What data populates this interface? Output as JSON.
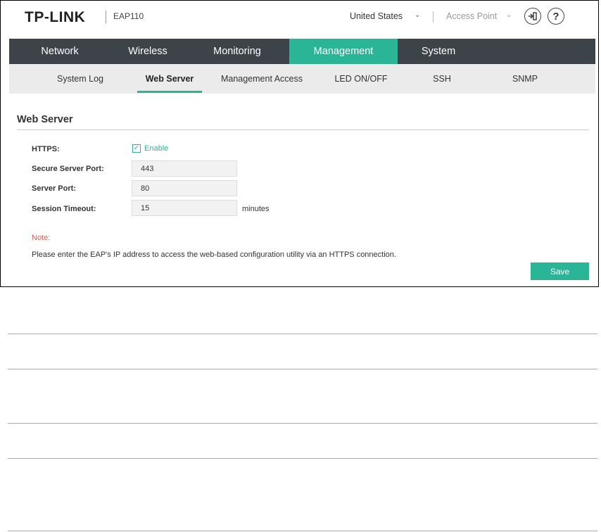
{
  "header": {
    "brand": "TP-LINK",
    "model": "EAP110",
    "region": "United States",
    "mode": "Access Point",
    "logout_icon": "logout-icon",
    "help_icon": "help-icon",
    "help_glyph": "?"
  },
  "main_nav": {
    "tabs": [
      {
        "label": "Network"
      },
      {
        "label": "Wireless"
      },
      {
        "label": "Monitoring"
      },
      {
        "label": "Management",
        "active": true
      },
      {
        "label": "System"
      }
    ]
  },
  "sub_nav": {
    "tabs": [
      {
        "label": "System Log"
      },
      {
        "label": "Web Server",
        "active": true
      },
      {
        "label": "Management Access"
      },
      {
        "label": "LED ON/OFF"
      },
      {
        "label": "SSH"
      },
      {
        "label": "SNMP"
      }
    ]
  },
  "web_server": {
    "title": "Web Server",
    "https_label": "HTTPS:",
    "https_enable_label": "Enable",
    "https_enabled": true,
    "secure_port_label": "Secure Server Port:",
    "secure_port_value": "443",
    "server_port_label": "Server Port:",
    "server_port_value": "80",
    "session_timeout_label": "Session Timeout:",
    "session_timeout_value": "15",
    "session_timeout_unit": "minutes",
    "note_title": "Note:",
    "note_text": "Please enter the EAP's IP address to access the web-based configuration utility via an HTTPS connection.",
    "save_label": "Save"
  },
  "colors": {
    "accent": "#2bb597",
    "nav_bg": "#3c4349",
    "subnav_bg": "#ebebeb",
    "note": "#e2584b"
  }
}
